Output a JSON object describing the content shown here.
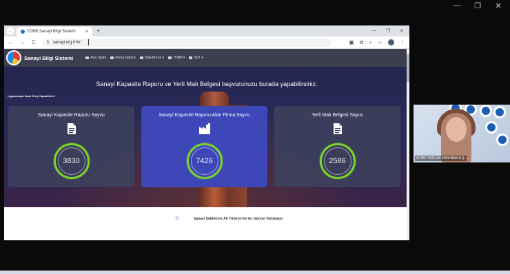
{
  "browser": {
    "tab_title": "TOBB Sanayi Bilgi Sistemi",
    "new_tab": "+",
    "url": "sanayi.org.tr/#/"
  },
  "site": {
    "brand": "Sanayi Bilgi Sistemi",
    "menu": [
      {
        "label": "Ana Sayfa"
      },
      {
        "label": "Firma Girişi ▾"
      },
      {
        "label": "Oda-Borsa ▾"
      },
      {
        "label": "TOBB ▾"
      },
      {
        "label": "SVT ▾"
      }
    ],
    "hero_title": "Sanayi Kapasite Raporu ve Yerli Malı Belgesi başvurunuzu burada yapabilirsiniz.",
    "help_link": "Uygulamaya Nasıl Giriş Yapabilirim?",
    "cards": [
      {
        "title": "Sanayi Kapasite Raporu Sayısı",
        "value": "3830",
        "icon": "document-icon"
      },
      {
        "title": "Sanayi Kapasite Raporu Alan Firma Sayısı",
        "value": "7426",
        "icon": "factory-icon"
      },
      {
        "title": "Yerli Malı Belgesi Sayısı",
        "value": "2586",
        "icon": "document-icon"
      }
    ],
    "footer_text": "Sanayi Sektörüne Ait Türkiye'nin En Güncel Veritabanı"
  },
  "video": {
    "participant_name": "ALTAY YAZILIM SAVUNMA A.Ş."
  },
  "colors": {
    "navbar": "#3c3f4f",
    "card_highlight": "#3d47b8",
    "ring": "#7bd52b"
  }
}
